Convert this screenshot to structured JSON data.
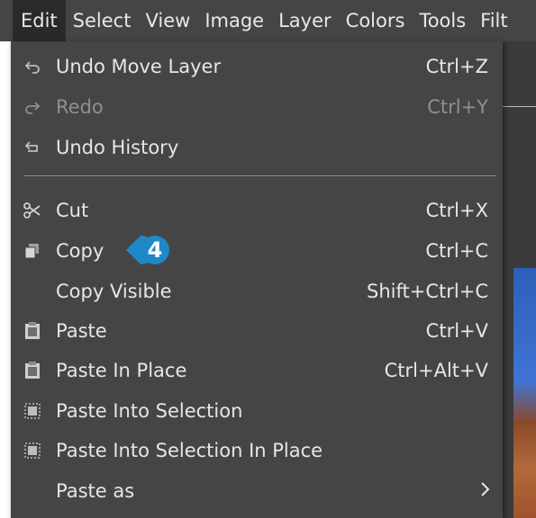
{
  "menubar": {
    "items": [
      "Edit",
      "Select",
      "View",
      "Image",
      "Layer",
      "Colors",
      "Tools",
      "Filt"
    ]
  },
  "edit_menu": {
    "items": [
      {
        "label": "Undo Move Layer",
        "shortcut": "Ctrl+Z",
        "icon": "undo-icon",
        "enabled": true
      },
      {
        "label": "Redo",
        "shortcut": "Ctrl+Y",
        "icon": "redo-icon",
        "enabled": false
      },
      {
        "label": "Undo History",
        "shortcut": "",
        "icon": "undo-history-icon",
        "enabled": true
      },
      {
        "label": "Cut",
        "shortcut": "Ctrl+X",
        "icon": "scissors-icon",
        "enabled": true
      },
      {
        "label": "Copy",
        "shortcut": "Ctrl+C",
        "icon": "copy-icon",
        "enabled": true
      },
      {
        "label": "Copy Visible",
        "shortcut": "Shift+Ctrl+C",
        "icon": "",
        "enabled": true
      },
      {
        "label": "Paste",
        "shortcut": "Ctrl+V",
        "icon": "paste-icon",
        "enabled": true
      },
      {
        "label": "Paste In Place",
        "shortcut": "Ctrl+Alt+V",
        "icon": "paste-in-place-icon",
        "enabled": true
      },
      {
        "label": "Paste Into Selection",
        "shortcut": "",
        "icon": "paste-into-selection-icon",
        "enabled": true
      },
      {
        "label": "Paste Into Selection In Place",
        "shortcut": "",
        "icon": "paste-into-selection-in-place-icon",
        "enabled": true
      },
      {
        "label": "Paste as",
        "shortcut": "",
        "icon": "",
        "enabled": true,
        "submenu": true
      }
    ]
  },
  "callout": {
    "number": "4",
    "color": "#1e88c8"
  },
  "colors": {
    "menu_bg": "#454545",
    "text": "#e6e6e6",
    "disabled_text": "#8f8f8f",
    "accent": "#1e88c8"
  }
}
